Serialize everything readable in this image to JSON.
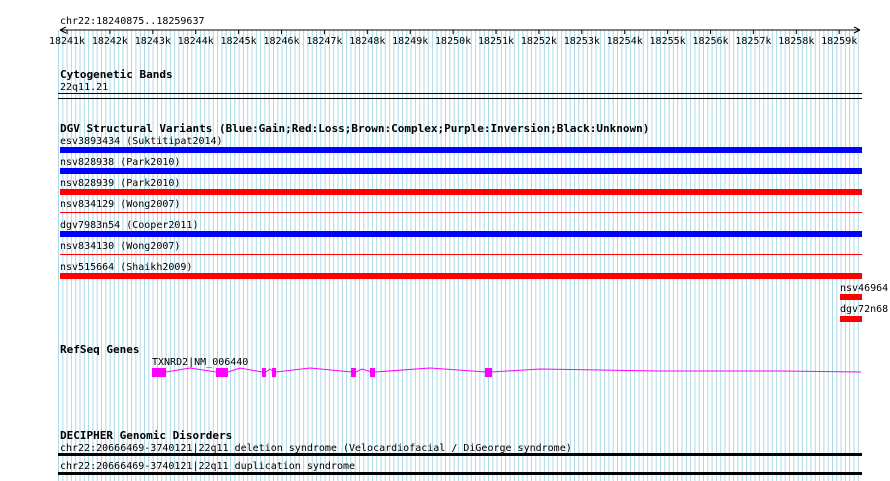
{
  "browser": {
    "region_label": "chr22:18240875..18259637",
    "ruler": {
      "ticks": [
        "18241k",
        "18242k",
        "18243k",
        "18244k",
        "18245k",
        "18246k",
        "18247k",
        "18248k",
        "18249k",
        "18250k",
        "18251k",
        "18252k",
        "18253k",
        "18254k",
        "18255k",
        "18256k",
        "18257k",
        "18258k",
        "18259k"
      ]
    },
    "tracks": {
      "cytoband": {
        "title": "Cytogenetic Bands",
        "band_label": "22q11.21"
      },
      "dgv": {
        "title": "DGV Structural Variants (Blue:Gain;Red:Loss;Brown:Complex;Purple:Inversion;Black:Unknown)",
        "colors": {
          "gain": "#0000ff",
          "loss": "#ff0000",
          "complex": "#8b4513",
          "inversion": "#800080",
          "unknown": "#000000"
        },
        "items": [
          {
            "label": "esv3893434 (Suktitipat2014)",
            "type": "gain",
            "height": "thick"
          },
          {
            "label": "nsv828938 (Park2010)",
            "type": "gain",
            "height": "thick"
          },
          {
            "label": "nsv828939 (Park2010)",
            "type": "loss",
            "height": "thick"
          },
          {
            "label": "nsv834129 (Wong2007)",
            "type": "loss",
            "height": "thin"
          },
          {
            "label": "dgv7983n54 (Cooper2011)",
            "type": "gain",
            "height": "thick"
          },
          {
            "label": "nsv834130 (Wong2007)",
            "type": "loss",
            "height": "thin"
          },
          {
            "label": "nsv515664 (Shaikh2009)",
            "type": "loss",
            "height": "thick"
          }
        ],
        "edge_items": [
          {
            "label": "nsv46964:",
            "type": "loss"
          },
          {
            "label": "dgv72n68",
            "type": "loss"
          }
        ]
      },
      "refseq": {
        "title": "RefSeq Genes",
        "gene_label": "TXNRD2|NM_006440",
        "color": "#ff00ff"
      },
      "decipher": {
        "title": "DECIPHER Genomic Disorders",
        "items": [
          {
            "label": "chr22:20666469-3740121|22q11 deletion syndrome (Velocardiofacial / DiGeorge syndrome)"
          },
          {
            "label": "chr22:20666469-3740121|22q11 duplication syndrome"
          }
        ]
      }
    }
  }
}
